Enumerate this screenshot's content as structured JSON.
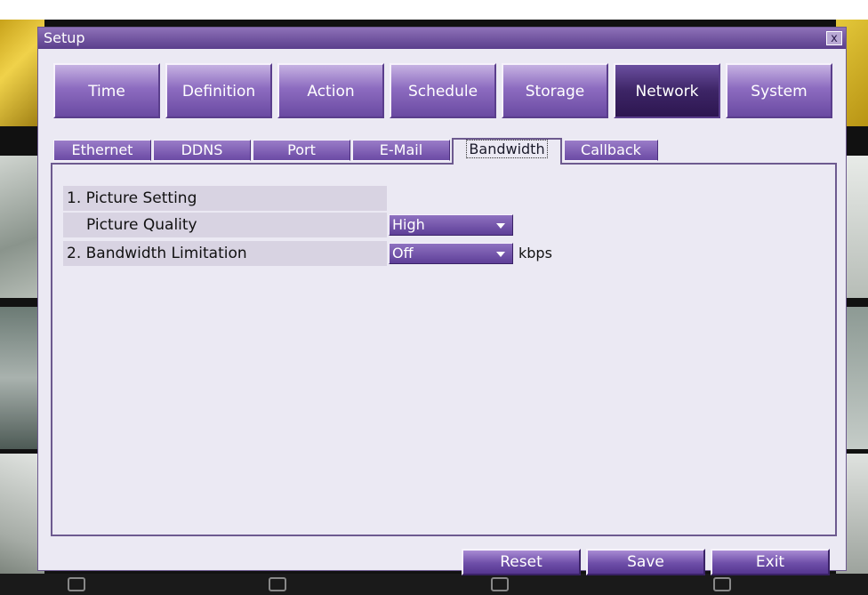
{
  "window": {
    "title": "Setup",
    "close_label": "x"
  },
  "main_tabs": [
    {
      "label": "Time",
      "active": false
    },
    {
      "label": "Definition",
      "active": false
    },
    {
      "label": "Action",
      "active": false
    },
    {
      "label": "Schedule",
      "active": false
    },
    {
      "label": "Storage",
      "active": false
    },
    {
      "label": "Network",
      "active": true
    },
    {
      "label": "System",
      "active": false
    }
  ],
  "sub_tabs": [
    {
      "label": "Ethernet",
      "active": false
    },
    {
      "label": "DDNS",
      "active": false
    },
    {
      "label": "Port",
      "active": false
    },
    {
      "label": "E-Mail",
      "active": false
    },
    {
      "label": "Bandwidth",
      "active": true
    },
    {
      "label": "Callback",
      "active": false
    }
  ],
  "settings": {
    "picture_setting_heading": "1. Picture Setting",
    "picture_quality_label": "Picture Quality",
    "picture_quality_value": "High",
    "bandwidth_limitation_label": "2. Bandwidth Limitation",
    "bandwidth_limitation_value": "Off",
    "bandwidth_unit": "kbps"
  },
  "buttons": {
    "reset": "Reset",
    "save": "Save",
    "exit": "Exit"
  },
  "colors": {
    "accent": "#6b4aa4",
    "active_tab": "#3d2566",
    "panel_bg": "#ebe9f3",
    "row_bg": "#d8d3e2"
  }
}
